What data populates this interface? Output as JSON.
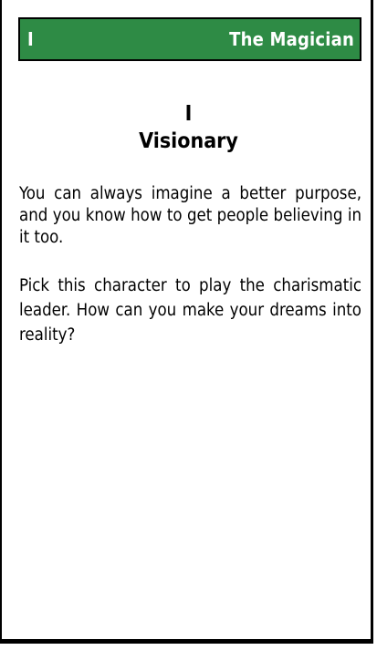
{
  "card": {
    "number": "I",
    "arcana": "The Magician",
    "role_number": "I",
    "role_title": "Visionary",
    "paragraph1": "You can always imagine a better purpose, and you know how to get people believing in it too.",
    "paragraph2": "Pick this character to play the charismatic leader. How can you make your dreams into reality?"
  },
  "colors": {
    "header_bg": "#2e8b45",
    "header_text": "#ffffff",
    "text": "#000000"
  }
}
